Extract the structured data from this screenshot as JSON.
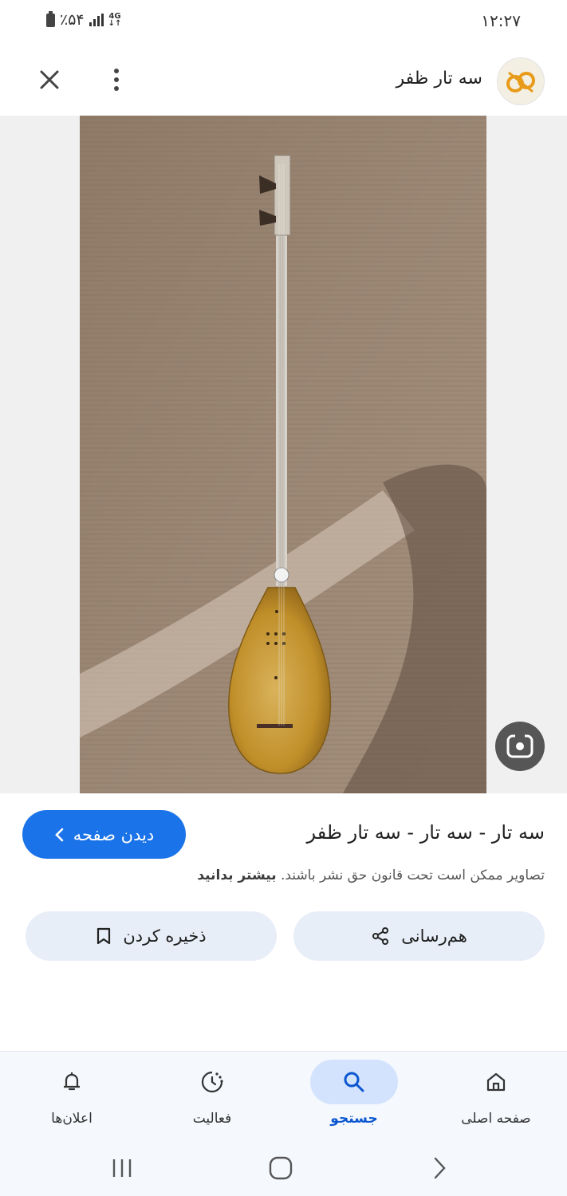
{
  "status_bar": {
    "battery_text": "٪۵۴",
    "network_type": "4G",
    "time": "۱۲:۲۷"
  },
  "header": {
    "title": "سه تار ظفر",
    "icons": [
      "close-icon",
      "more-vert-icon",
      "site-logo"
    ]
  },
  "result": {
    "title": "سه تار - سه تار - سه تار ظفر",
    "visit_label": "دیدن صفحه",
    "copyright_text": "تصاویر ممکن است تحت قانون حق نشر باشند.",
    "learn_more_label": "بیشتر بدانید"
  },
  "actions": {
    "share_label": "هم‌رسانی",
    "save_label": "ذخیره کردن"
  },
  "bottom_nav": {
    "items": [
      {
        "label": "اعلان‌ها",
        "icon": "bell-icon"
      },
      {
        "label": "فعالیت",
        "icon": "activity-icon"
      },
      {
        "label": "جستجو",
        "icon": "search-icon",
        "active": true
      },
      {
        "label": "صفحه اصلی",
        "icon": "home-icon"
      }
    ]
  },
  "colors": {
    "accent": "#1a73e8",
    "action_bg": "#e8eef8",
    "nav_active": "#d3e3fd"
  }
}
